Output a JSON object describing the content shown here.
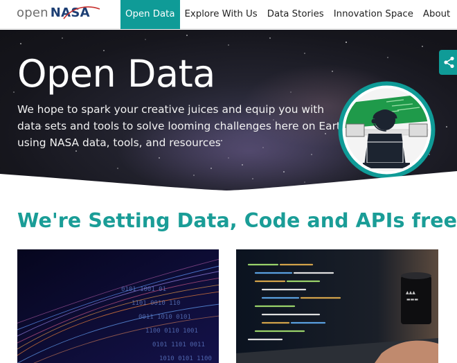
{
  "nav": {
    "logo_open": "open",
    "logo_nasa": "NASA",
    "links": [
      {
        "label": "Open Data",
        "active": true
      },
      {
        "label": "Explore With Us",
        "active": false
      },
      {
        "label": "Data Stories",
        "active": false
      },
      {
        "label": "Innovation Space",
        "active": false
      },
      {
        "label": "About",
        "active": false
      }
    ]
  },
  "hero": {
    "title": "Open Data",
    "subtitle": "We hope to spark your creative juices and equip you with data sets and tools to solve looming challenges here on Earth using NASA data, tools, and resources",
    "badge_icon": "data-scientist-icon",
    "share_icon": "share-icon"
  },
  "main": {
    "section_title": "We're Setting Data, Code and APIs free",
    "cards": [
      {
        "image": "binary-data-stream-image"
      },
      {
        "image": "code-on-laptop-image"
      }
    ]
  },
  "colors": {
    "accent": "#0f9b97",
    "heading": "#1a9d97",
    "nasa_blue": "#1d3f74"
  }
}
